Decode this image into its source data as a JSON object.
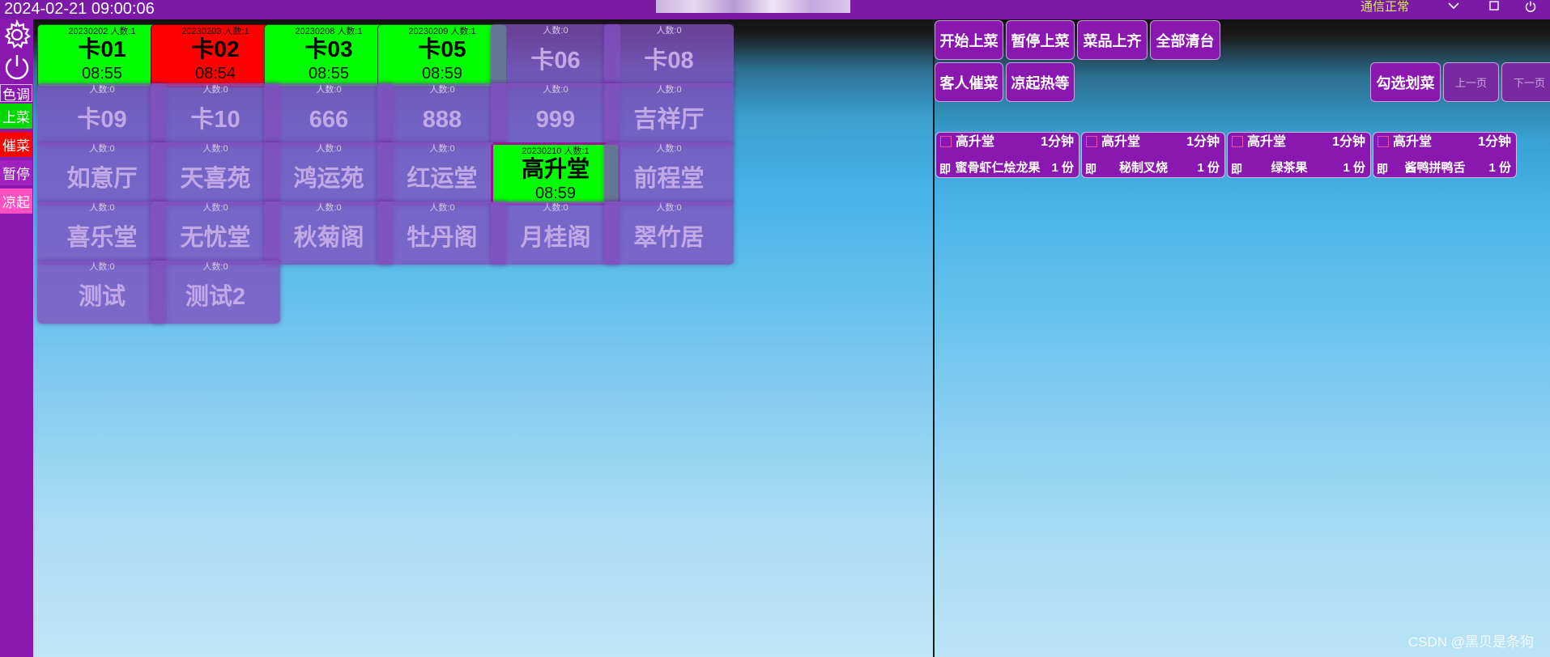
{
  "topbar": {
    "datetime": "2024-02-21 09:00:06",
    "comm_status": "通信正常",
    "colors": {
      "bar": "#7a1aa6",
      "status": "#d7f14a"
    }
  },
  "sidebar": {
    "settings_icon": "gear-icon",
    "power_icon": "power-icon",
    "buttons": [
      {
        "label": "色调",
        "bg": "#8a18b0"
      },
      {
        "label": "上菜",
        "bg": "#00d800"
      },
      {
        "label": "催菜",
        "bg": "#ff0000"
      },
      {
        "label": "暂停",
        "bg": "#a020c0"
      },
      {
        "label": "凉起",
        "bg": "#ff4fc0"
      }
    ]
  },
  "cards": [
    {
      "name": "卡01",
      "info": "20230202 人数:1",
      "time": "08:55",
      "state": "green"
    },
    {
      "name": "卡02",
      "info": "20230203 人数:1",
      "time": "08:54",
      "state": "red"
    },
    {
      "name": "卡03",
      "info": "20230208 人数:1",
      "time": "08:55",
      "state": "green"
    },
    {
      "name": "卡05",
      "info": "20230209 人数:1",
      "time": "08:59",
      "state": "green"
    },
    {
      "name": "卡06",
      "info": "人数:0",
      "state": "idle"
    },
    {
      "name": "卡08",
      "info": "人数:0",
      "state": "idle"
    },
    {
      "name": "卡09",
      "info": "人数:0",
      "state": "idle"
    },
    {
      "name": "卡10",
      "info": "人数:0",
      "state": "idle"
    },
    {
      "name": "666",
      "info": "人数:0",
      "state": "idle"
    },
    {
      "name": "888",
      "info": "人数:0",
      "state": "idle"
    },
    {
      "name": "999",
      "info": "人数:0",
      "state": "idle"
    },
    {
      "name": "吉祥厅",
      "info": "人数:0",
      "state": "idle"
    },
    {
      "name": "如意厅",
      "info": "人数:0",
      "state": "idle"
    },
    {
      "name": "天喜苑",
      "info": "人数:0",
      "state": "idle"
    },
    {
      "name": "鸿运苑",
      "info": "人数:0",
      "state": "idle"
    },
    {
      "name": "红运堂",
      "info": "人数:0",
      "state": "idle"
    },
    {
      "name": "高升堂",
      "info": "20230210 人数:1",
      "time": "08:59",
      "state": "sel"
    },
    {
      "name": "前程堂",
      "info": "人数:0",
      "state": "idle"
    },
    {
      "name": "喜乐堂",
      "info": "人数:0",
      "state": "idle"
    },
    {
      "name": "无忧堂",
      "info": "人数:0",
      "state": "idle"
    },
    {
      "name": "秋菊阁",
      "info": "人数:0",
      "state": "idle"
    },
    {
      "name": "牡丹阁",
      "info": "人数:0",
      "state": "idle"
    },
    {
      "name": "月桂阁",
      "info": "人数:0",
      "state": "idle"
    },
    {
      "name": "翠竹居",
      "info": "人数:0",
      "state": "idle"
    },
    {
      "name": "测试",
      "info": "人数:0",
      "state": "idle"
    },
    {
      "name": "测试2",
      "info": "人数:0",
      "state": "idle"
    }
  ],
  "actions": {
    "start": "开始上菜",
    "pause": "暂停上菜",
    "all_served": "菜品上齐",
    "clear_all": "全部清台",
    "urge": "客人催菜",
    "cold_hot_wait": "凉起热等",
    "check_dish": "勾选划菜",
    "prev_page": "上一页",
    "next_page": "下一页"
  },
  "orders": [
    {
      "table": "高升堂",
      "mins": "1分钟",
      "ji": "即",
      "dish": "蜜骨虾仁烩龙果",
      "qty": "1 份"
    },
    {
      "table": "高升堂",
      "mins": "1分钟",
      "ji": "即",
      "dish": "秘制叉烧",
      "qty": "1 份"
    },
    {
      "table": "高升堂",
      "mins": "1分钟",
      "ji": "即",
      "dish": "绿茶果",
      "qty": "1 份"
    },
    {
      "table": "高升堂",
      "mins": "1分钟",
      "ji": "即",
      "dish": "酱鸭拼鸭舌",
      "qty": "1 份"
    }
  ],
  "watermark": "CSDN @黑贝是条狗"
}
